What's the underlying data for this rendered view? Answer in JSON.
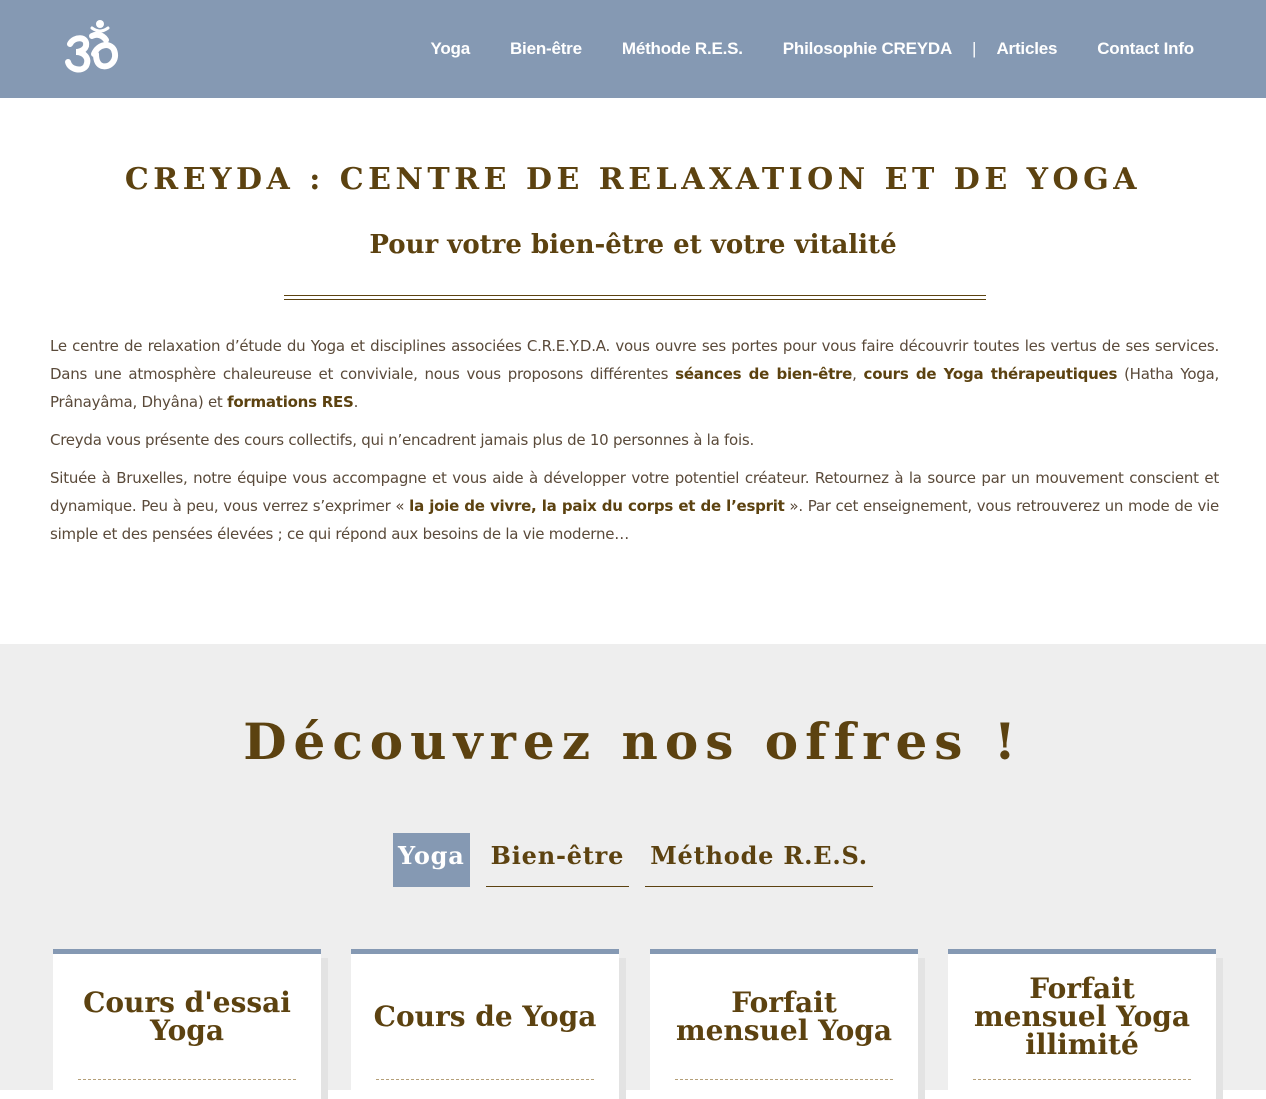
{
  "header": {
    "logo_icon": "om-icon",
    "nav": [
      {
        "label": "Yoga"
      },
      {
        "label": "Bien-être"
      },
      {
        "label": "Méthode R.E.S."
      },
      {
        "label": "Philosophie CREYDA"
      },
      {
        "label": "Articles"
      },
      {
        "label": "Contact Info"
      }
    ],
    "separator": "|"
  },
  "intro": {
    "title": "CREYDA : CENTRE DE RELAXATION ET DE YOGA",
    "subtitle": "Pour votre bien-être et votre vitalité",
    "p1": {
      "a": "Le centre de relaxation d’étude du Yoga et disciplines associées C.R.E.Y.D.A. vous ouvre ses portes pour vous faire découvrir toutes les vertus de ses services. Dans une atmosphère chaleureuse et conviviale, nous vous proposons différentes ",
      "b1": "séances de bien-être",
      "c": ", ",
      "b2": "cours de Yoga thérapeutiques",
      "d": " (Hatha Yoga, Prânayâma, Dhyâna) et ",
      "b3": "formations RES",
      "e": "."
    },
    "p2": "Creyda vous présente des cours collectifs, qui n’encadrent jamais plus de 10 personnes à la fois.",
    "p3": {
      "a": "Située à Bruxelles, notre équipe vous accompagne et vous aide à développer votre potentiel créateur. Retournez à la source par un mouvement conscient et dynamique. Peu à peu, vous verrez s’exprimer « ",
      "b": "la joie de vivre, la paix du corps et de l’esprit",
      "c": " ». Par cet enseignement, vous retrouverez un mode de vie simple et des pensées élevées ; ce qui répond aux besoins de la vie moderne…"
    }
  },
  "offers": {
    "title": "Découvrez nos offres !",
    "tabs": [
      {
        "label": "Yoga",
        "active": true
      },
      {
        "label": "Bien-être",
        "active": false
      },
      {
        "label": "Méthode R.E.S.",
        "active": false
      }
    ],
    "cards": [
      {
        "title": "Cours d'essai Yoga"
      },
      {
        "title": "Cours de Yoga"
      },
      {
        "title": "Forfait mensuel Yoga"
      },
      {
        "title": "Forfait mensuel Yoga illimité"
      }
    ]
  },
  "colors": {
    "header_bg": "#8599b3",
    "accent_brown": "#5c4210",
    "section_gray": "#eeeeee"
  }
}
